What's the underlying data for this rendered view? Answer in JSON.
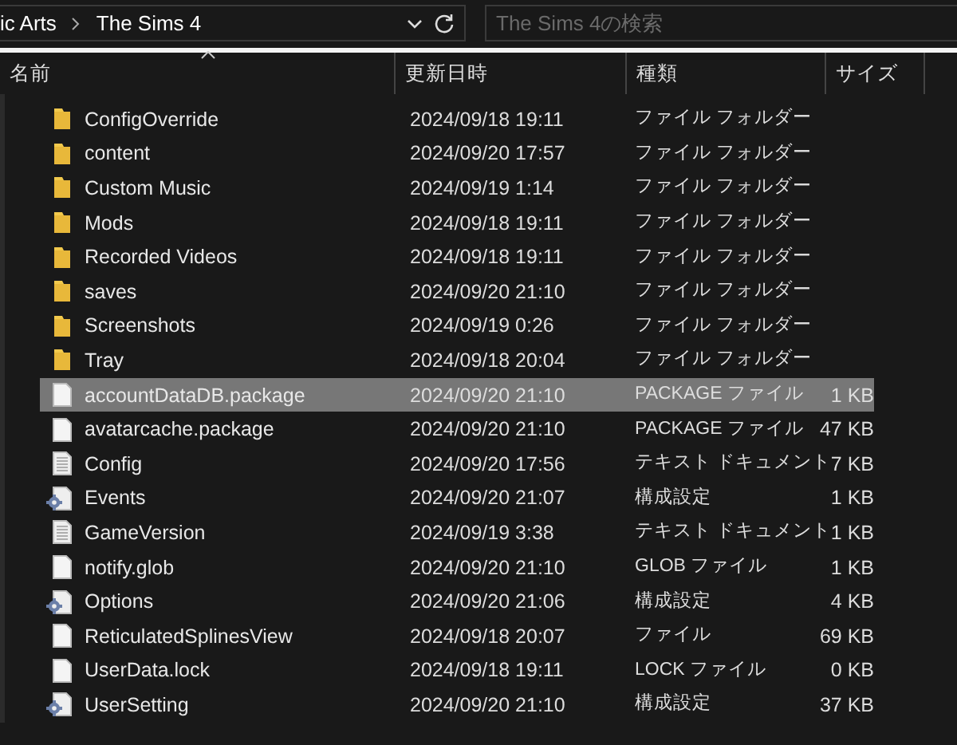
{
  "address_bar": {
    "crumbs": [
      "ic Arts",
      "The Sims 4"
    ]
  },
  "search": {
    "placeholder": "The Sims 4の検索"
  },
  "table": {
    "columns": [
      "名前",
      "更新日時",
      "種類",
      "サイズ"
    ],
    "rows": [
      {
        "kind": "folder",
        "name": "ConfigOverride",
        "modified": "2024/09/18 19:11",
        "type": "ファイル フォルダー",
        "selected": false
      },
      {
        "kind": "folder",
        "name": "content",
        "modified": "2024/09/20 17:57",
        "type": "ファイル フォルダー",
        "selected": false
      },
      {
        "kind": "folder",
        "name": "Custom Music",
        "modified": "2024/09/19 1:14",
        "type": "ファイル フォルダー",
        "selected": false
      },
      {
        "kind": "folder",
        "name": "Mods",
        "modified": "2024/09/18 19:11",
        "type": "ファイル フォルダー",
        "selected": false
      },
      {
        "kind": "folder",
        "name": "Recorded Videos",
        "modified": "2024/09/18 19:11",
        "type": "ファイル フォルダー",
        "selected": false
      },
      {
        "kind": "folder",
        "name": "saves",
        "modified": "2024/09/20 21:10",
        "type": "ファイル フォルダー",
        "selected": false
      },
      {
        "kind": "folder",
        "name": "Screenshots",
        "modified": "2024/09/19 0:26",
        "type": "ファイル フォルダー",
        "selected": false
      },
      {
        "kind": "folder",
        "name": "Tray",
        "modified": "2024/09/18 20:04",
        "type": "ファイル フォルダー",
        "selected": false
      },
      {
        "kind": "file",
        "name": "accountDataDB.package",
        "modified": "2024/09/20 21:10",
        "type": "PACKAGE ファイル",
        "size": "1 KB",
        "selected": true
      },
      {
        "kind": "file",
        "name": "avatarcache.package",
        "modified": "2024/09/20 21:10",
        "type": "PACKAGE ファイル",
        "size": "47 KB",
        "selected": false
      },
      {
        "kind": "text",
        "name": "Config",
        "modified": "2024/09/20 17:56",
        "type": "テキスト ドキュメント",
        "size": "7 KB",
        "selected": false
      },
      {
        "kind": "settings",
        "name": "Events",
        "modified": "2024/09/20 21:07",
        "type": "構成設定",
        "size": "1 KB",
        "selected": false
      },
      {
        "kind": "text",
        "name": "GameVersion",
        "modified": "2024/09/19 3:38",
        "type": "テキスト ドキュメント",
        "size": "1 KB",
        "selected": false
      },
      {
        "kind": "file",
        "name": "notify.glob",
        "modified": "2024/09/20 21:10",
        "type": "GLOB ファイル",
        "size": "1 KB",
        "selected": false
      },
      {
        "kind": "settings",
        "name": "Options",
        "modified": "2024/09/20 21:06",
        "type": "構成設定",
        "size": "4 KB",
        "selected": false
      },
      {
        "kind": "file",
        "name": "ReticulatedSplinesView",
        "modified": "2024/09/18 20:07",
        "type": "ファイル",
        "size": "69 KB",
        "selected": false
      },
      {
        "kind": "file",
        "name": "UserData.lock",
        "modified": "2024/09/18 19:11",
        "type": "LOCK ファイル",
        "size": "0 KB",
        "selected": false
      },
      {
        "kind": "settings",
        "name": "UserSetting",
        "modified": "2024/09/20 21:10",
        "type": "構成設定",
        "size": "37 KB",
        "selected": false
      }
    ]
  }
}
